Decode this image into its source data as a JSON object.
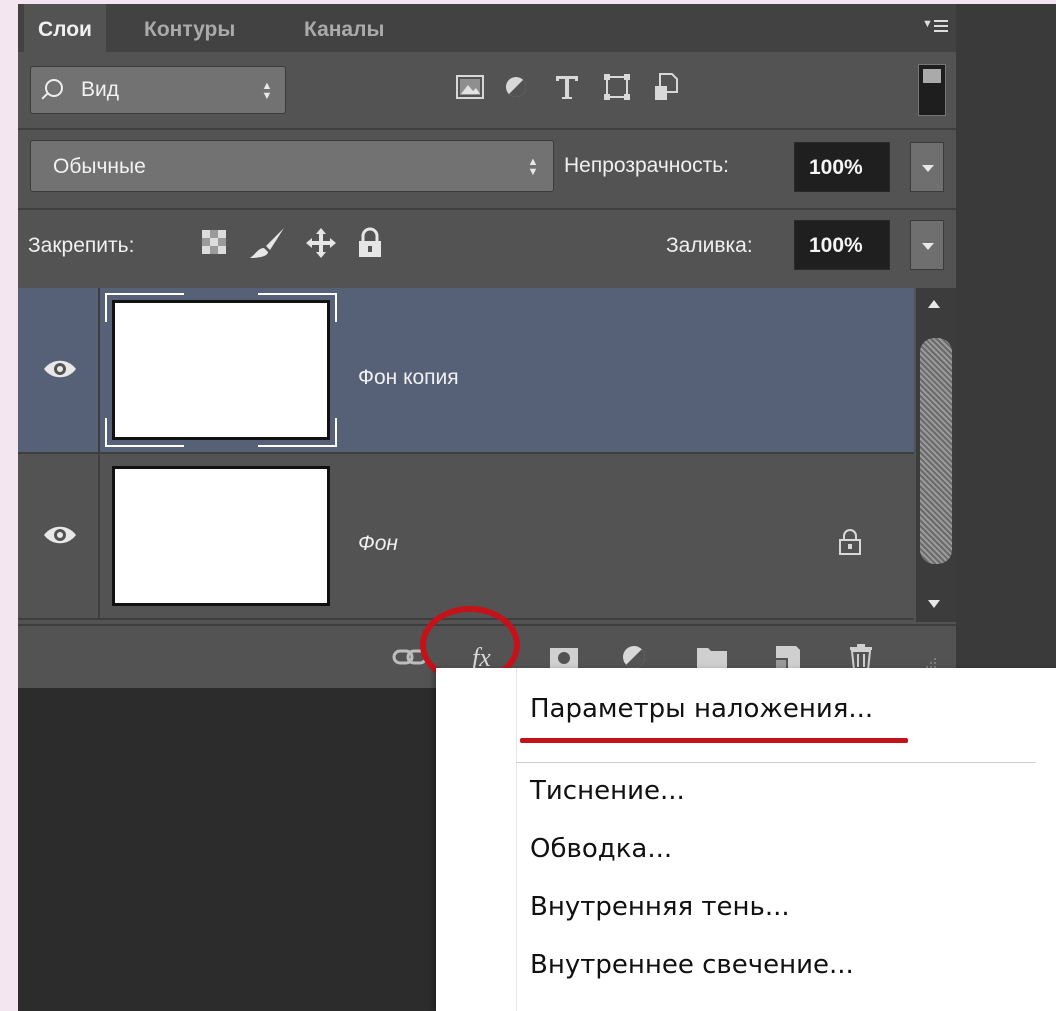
{
  "tabs": [
    {
      "label": "Слои",
      "active": true
    },
    {
      "label": "Контуры",
      "active": false
    },
    {
      "label": "Каналы",
      "active": false
    }
  ],
  "filter": {
    "label": "Вид",
    "icons": [
      "image-filter-icon",
      "adjustment-filter-icon",
      "type-filter-icon",
      "shape-filter-icon",
      "smart-object-filter-icon"
    ]
  },
  "blend": {
    "mode": "Обычные",
    "opacity_label": "Непрозрачность:",
    "opacity_value": "100%"
  },
  "lock": {
    "label": "Закрепить:",
    "fill_label": "Заливка:",
    "fill_value": "100%"
  },
  "layers": [
    {
      "name": "Фон копия",
      "selected": true,
      "visible": true,
      "locked": false,
      "italic": false
    },
    {
      "name": "Фон",
      "selected": false,
      "visible": true,
      "locked": true,
      "italic": true
    }
  ],
  "bottom_toolbar": {
    "fx_label": "fx",
    "icons": [
      "link-layers-icon",
      "fx-icon",
      "layer-mask-icon",
      "adjustment-layer-icon",
      "group-folder-icon",
      "new-layer-icon",
      "trash-icon"
    ]
  },
  "menu": {
    "items": [
      "Параметры наложения...",
      "Тиснение...",
      "Обводка...",
      "Внутренняя тень...",
      "Внутреннее свечение..."
    ]
  },
  "colors": {
    "highlight": "#c4121a",
    "selected_row": "#566178",
    "panel": "#535353"
  }
}
